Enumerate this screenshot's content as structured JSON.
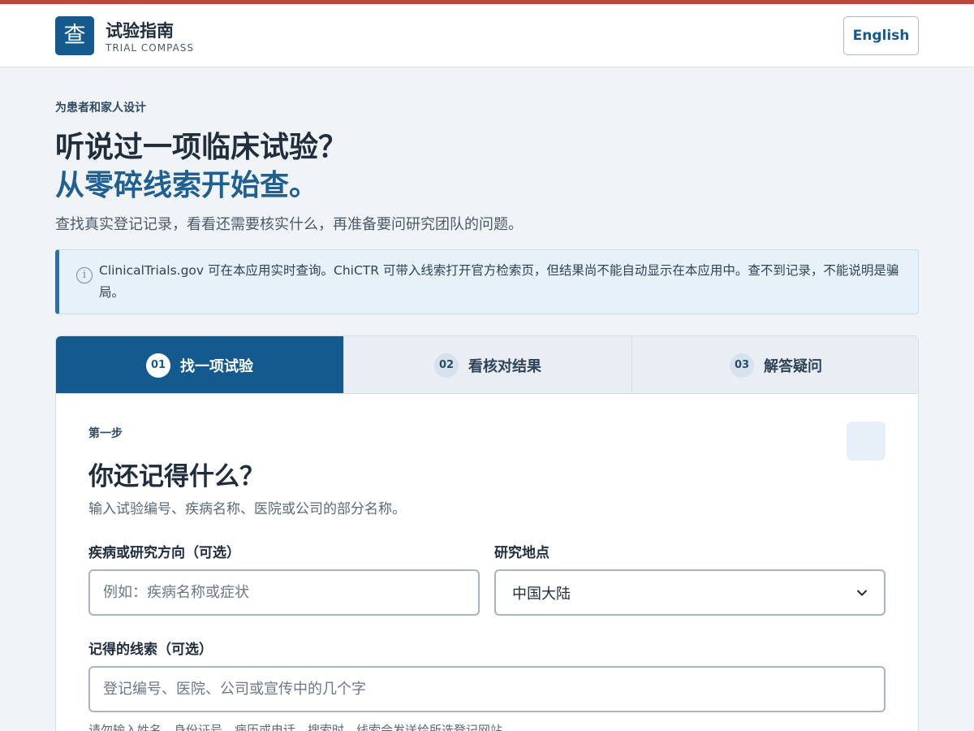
{
  "header": {
    "logo_glyph": "查",
    "brand_title": "试验指南",
    "brand_subtitle": "TRIAL COMPASS",
    "language_button": "English"
  },
  "hero": {
    "eyebrow": "为患者和家人设计",
    "title_line1": "听说过一项临床试验？",
    "title_line2": "从零碎线索开始查。",
    "description": "查找真实登记记录，看看还需要核实什么，再准备要问研究团队的问题。"
  },
  "notice": {
    "icon": "info-icon",
    "text": "ClinicalTrials.gov 可在本应用实时查询。ChiCTR 可带入线索打开官方检索页，但结果尚不能自动显示在本应用中。查不到记录，不能说明是骗局。"
  },
  "tabs": [
    {
      "num": "01",
      "label": "找一项试验",
      "active": true
    },
    {
      "num": "02",
      "label": "看核对结果",
      "active": false
    },
    {
      "num": "03",
      "label": "解答疑问",
      "active": false
    }
  ],
  "step": {
    "label": "第一步",
    "title": "你还记得什么？",
    "description": "输入试验编号、疾病名称、医院或公司的部分名称。"
  },
  "form": {
    "condition_label": "疾病或研究方向（可选）",
    "condition_placeholder": "例如：疾病名称或症状",
    "location_label": "研究地点",
    "location_value": "中国大陆",
    "clue_label": "记得的线索（可选）",
    "clue_placeholder": "登记编号、医院、公司或宣传中的几个字",
    "helper_text": "请勿输入姓名、身份证号、病历或电话。搜索时，线索会发送给所选登记网站。"
  },
  "colors": {
    "accent_bar": "#b9473a",
    "brand": "#155a8e",
    "headline_blue": "#1f5f92"
  }
}
